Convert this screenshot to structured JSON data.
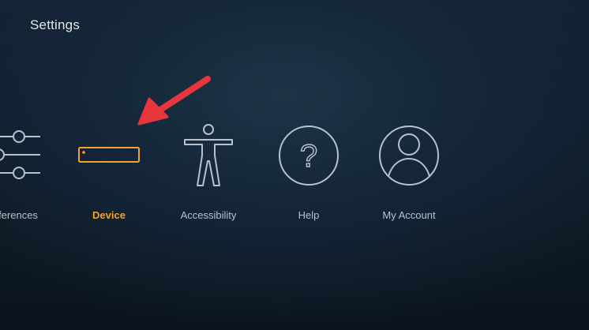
{
  "header": {
    "title": "Settings"
  },
  "menu": {
    "items": [
      {
        "label": "ferences",
        "icon": "sliders-icon",
        "selected": false
      },
      {
        "label": "Device",
        "icon": "device-box-icon",
        "selected": true
      },
      {
        "label": "Accessibility",
        "icon": "accessibility-icon",
        "selected": false
      },
      {
        "label": "Help",
        "icon": "question-circle-icon",
        "selected": false
      },
      {
        "label": "My Account",
        "icon": "account-icon",
        "selected": false
      }
    ]
  },
  "annotation": {
    "type": "arrow",
    "color": "#e8363d",
    "points_to": "Device"
  },
  "colors": {
    "selected": "#f0a52a",
    "icon_stroke": "#b9c1ca",
    "label": "#b9c1ca",
    "title": "#e3e7ec"
  }
}
